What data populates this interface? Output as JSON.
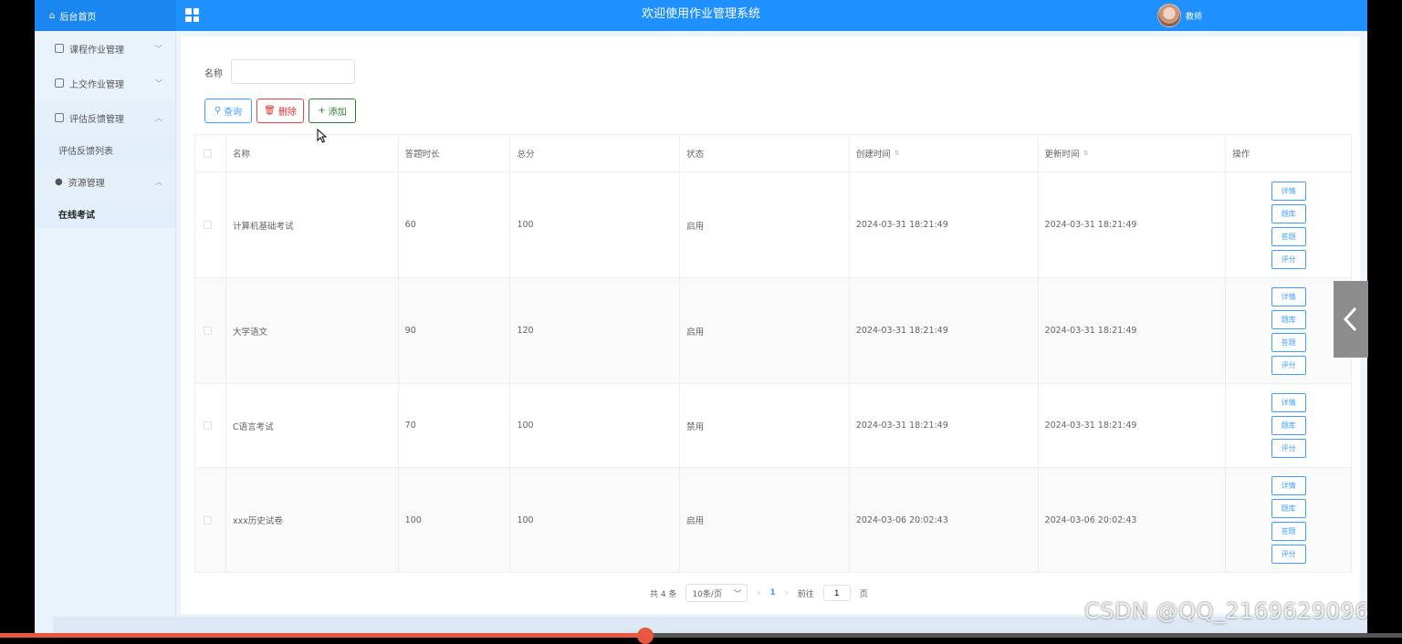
{
  "header": {
    "home_label": "后台首页",
    "title": "欢迎使用作业管理系统",
    "user_name": "教师"
  },
  "sidebar": {
    "items": [
      {
        "label": "课程作业管理"
      },
      {
        "label": "上交作业管理"
      },
      {
        "label": "评估反馈管理"
      },
      {
        "label": "评估反馈列表"
      },
      {
        "label": "资源管理"
      },
      {
        "label": "在线考试"
      }
    ]
  },
  "search": {
    "label": "名称",
    "value": "",
    "placeholder": ""
  },
  "toolbar": {
    "query_label": "查询",
    "delete_label": "删除",
    "add_label": "添加"
  },
  "table": {
    "columns": [
      "名称",
      "答题时长",
      "总分",
      "状态",
      "创建时间",
      "更新时间",
      "操作"
    ],
    "rows": [
      {
        "name": "计算机基础考试",
        "duration": "60",
        "score": "100",
        "status": "启用",
        "created": "2024-03-31 18:21:49",
        "updated": "2024-03-31 18:21:49",
        "ops": [
          "详情",
          "题库",
          "答题",
          "评分"
        ]
      },
      {
        "name": "大学语文",
        "duration": "90",
        "score": "120",
        "status": "启用",
        "created": "2024-03-31 18:21:49",
        "updated": "2024-03-31 18:21:49",
        "ops": [
          "详情",
          "题库",
          "答题",
          "评分"
        ]
      },
      {
        "name": "C语言考试",
        "duration": "70",
        "score": "100",
        "status": "禁用",
        "created": "2024-03-31 18:21:49",
        "updated": "2024-03-31 18:21:49",
        "ops": [
          "详情",
          "题库",
          "评分"
        ]
      },
      {
        "name": "xxx历史试卷",
        "duration": "100",
        "score": "100",
        "status": "启用",
        "created": "2024-03-06 20:02:43",
        "updated": "2024-03-06 20:02:43",
        "ops": [
          "详情",
          "题库",
          "答题",
          "评分"
        ]
      }
    ]
  },
  "pagination": {
    "total_text": "共 4 条",
    "page_size": "10条/页",
    "current_page": "1",
    "goto_label": "前往",
    "goto_value": "1",
    "page_suffix": "页"
  },
  "watermark": "CSDN @QQ_2169629096",
  "colors": {
    "header": "#1e90ff",
    "primary": "#409eff",
    "danger": "#e64242",
    "success": "#2e7d32"
  }
}
